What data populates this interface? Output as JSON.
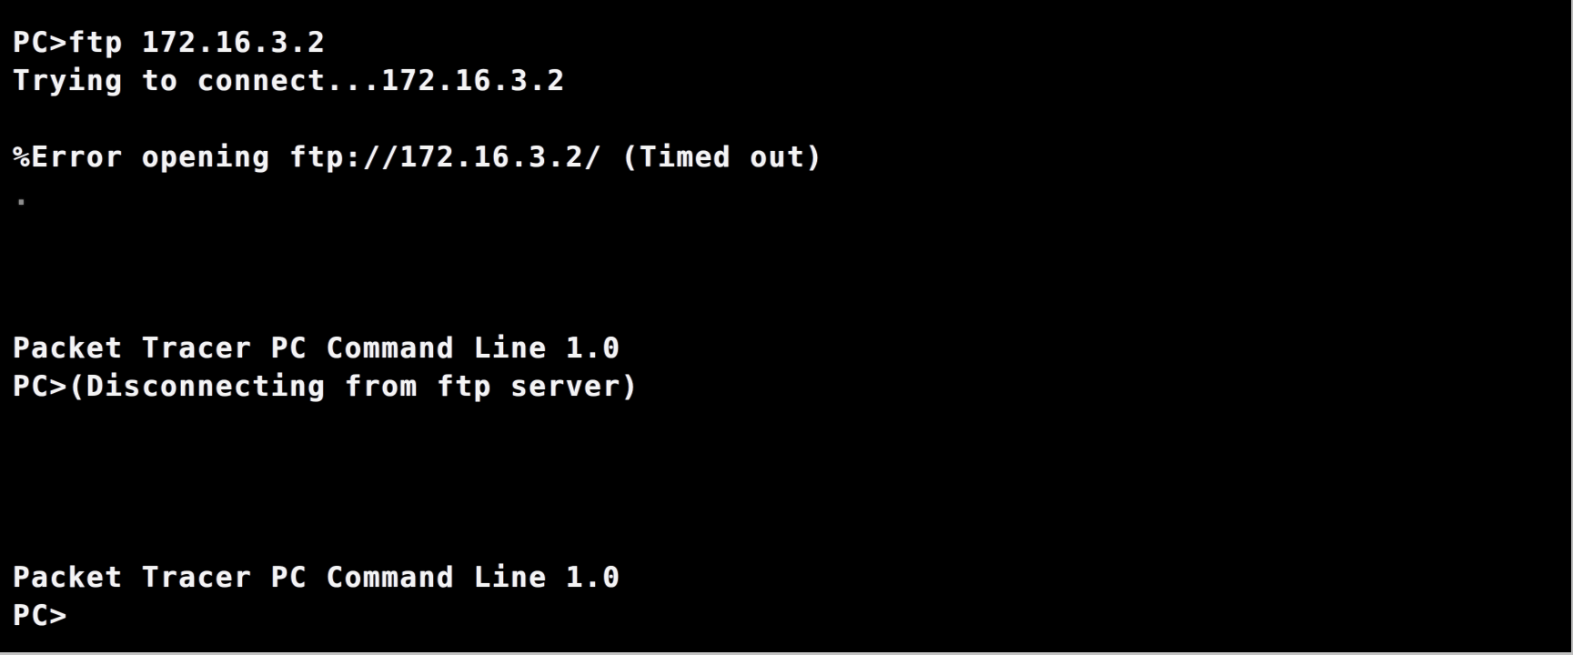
{
  "terminal": {
    "title": "Packet Tracer PC Command Line",
    "background_color": "#000000",
    "text_color": "#f4f4f4",
    "border_color": "#bdbdbd",
    "lines": [
      {
        "id": "cmd-ftp",
        "text": "PC>ftp 172.16.3.2",
        "kind": "command"
      },
      {
        "id": "connect-attempt",
        "text": "Trying to connect...172.16.3.2",
        "kind": "output"
      },
      {
        "id": "spacer-1",
        "text": "",
        "kind": "blank"
      },
      {
        "id": "error-timed-out",
        "text": "%Error opening ftp://172.16.3.2/ (Timed out)",
        "kind": "error"
      },
      {
        "id": "trailing-dot",
        "text": ".",
        "kind": "faint"
      },
      {
        "id": "spacer-2",
        "text": "",
        "kind": "blank"
      },
      {
        "id": "spacer-3",
        "text": "",
        "kind": "blank"
      },
      {
        "id": "spacer-4",
        "text": "",
        "kind": "blank"
      },
      {
        "id": "banner-1",
        "text": "Packet Tracer PC Command Line 1.0",
        "kind": "banner"
      },
      {
        "id": "disconnect-notice",
        "text": "PC>(Disconnecting from ftp server)",
        "kind": "output"
      },
      {
        "id": "spacer-5",
        "text": "",
        "kind": "blank"
      },
      {
        "id": "spacer-6",
        "text": "",
        "kind": "blank"
      },
      {
        "id": "spacer-7",
        "text": "",
        "kind": "blank"
      },
      {
        "id": "spacer-8",
        "text": "",
        "kind": "blank"
      },
      {
        "id": "banner-2",
        "text": "Packet Tracer PC Command Line 1.0",
        "kind": "banner"
      },
      {
        "id": "prompt-final",
        "text": "PC>",
        "kind": "prompt"
      }
    ]
  }
}
